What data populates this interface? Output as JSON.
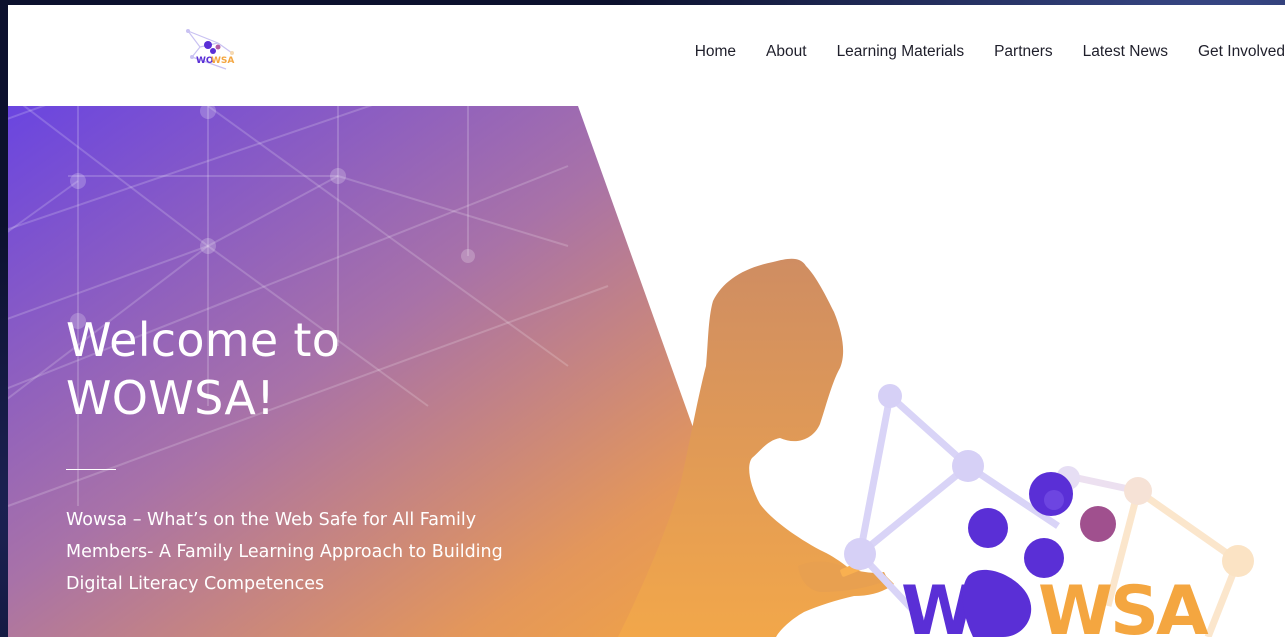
{
  "header": {
    "logo_text": "WOWSA",
    "nav": [
      {
        "label": "Home"
      },
      {
        "label": "About"
      },
      {
        "label": "Learning Materials"
      },
      {
        "label": "Partners"
      },
      {
        "label": "Latest News"
      },
      {
        "label": "Get Involved"
      }
    ]
  },
  "hero": {
    "title": "Welcome to WOWSA!",
    "subtitle": "Wowsa – What’s on the Web Safe for All Family Members- A Family Learning Approach to Building Digital Literacy Competences",
    "graphic_logo_text": "WOWSA"
  },
  "colors": {
    "gradient_start": "#6a45e0",
    "gradient_end": "#f2a24a",
    "brand_purple": "#5a2fd6",
    "brand_orange": "#f4a640",
    "nav_text": "#1f1f2b"
  },
  "icons": {
    "logo": "wowsa-network-logo",
    "silhouette": "person-using-phone-silhouette"
  }
}
